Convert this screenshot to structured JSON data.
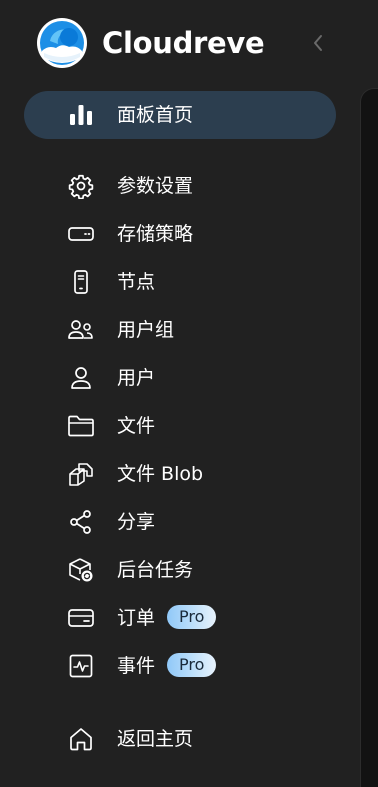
{
  "app": {
    "title": "Cloudreve"
  },
  "nav": {
    "items": [
      {
        "label": "面板首页",
        "icon": "bar-chart-icon",
        "active": true
      },
      {
        "label": "参数设置",
        "icon": "gear-icon"
      },
      {
        "label": "存储策略",
        "icon": "storage-icon"
      },
      {
        "label": "节点",
        "icon": "device-icon"
      },
      {
        "label": "用户组",
        "icon": "user-group-icon"
      },
      {
        "label": "用户",
        "icon": "user-icon"
      },
      {
        "label": "文件",
        "icon": "folder-icon"
      },
      {
        "label": "文件 Blob",
        "icon": "blob-icon"
      },
      {
        "label": "分享",
        "icon": "share-icon"
      },
      {
        "label": "后台任务",
        "icon": "task-icon"
      },
      {
        "label": "订单",
        "icon": "card-icon",
        "badge": "Pro"
      },
      {
        "label": "事件",
        "icon": "activity-icon",
        "badge": "Pro"
      },
      {
        "label": "返回主页",
        "icon": "home-icon"
      }
    ]
  },
  "colors": {
    "background": "#212121",
    "active_item": "#2c3e4f",
    "text": "#ffffff",
    "badge_gradient_start": "#90c8f8"
  }
}
